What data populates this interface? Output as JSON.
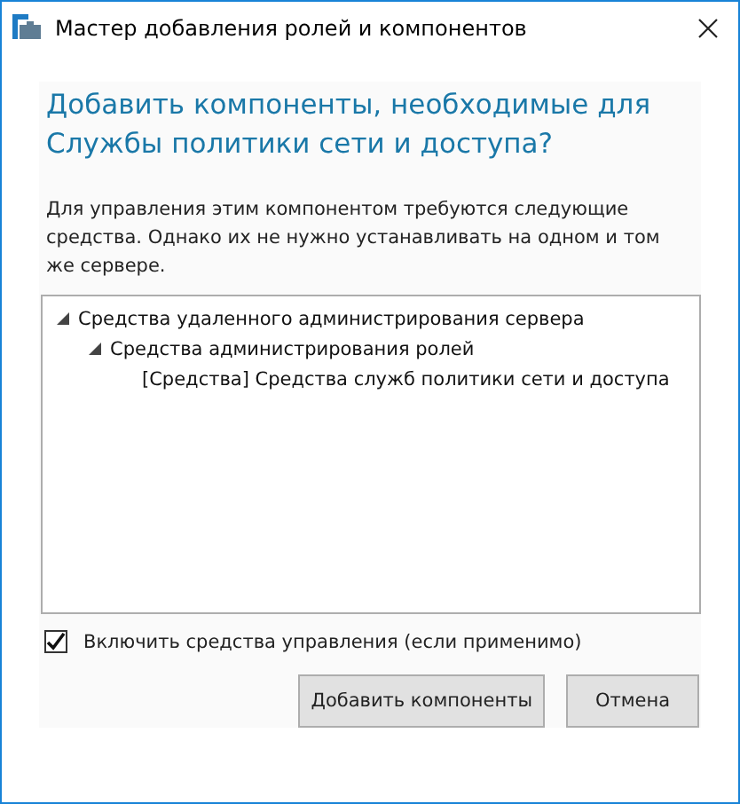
{
  "window": {
    "title": "Мастер добавления ролей и компонентов"
  },
  "heading": "Добавить компоненты, необходимые для Службы политики сети и доступа?",
  "description": "Для управления этим компонентом требуются следующие средства. Однако их не нужно устанавливать на одном и том же сервере.",
  "tree": [
    {
      "label": "Средства удаленного администрирования сервера",
      "expanded": true,
      "children": [
        {
          "label": "Средства администрирования ролей",
          "expanded": true,
          "children": [
            {
              "label": "[Средства] Средства служб политики сети и доступа"
            }
          ]
        }
      ]
    }
  ],
  "include_tools": {
    "label": "Включить средства управления (если применимо)",
    "checked": true
  },
  "buttons": [
    {
      "label": "Добавить компоненты"
    },
    {
      "label": "Отмена"
    }
  ]
}
